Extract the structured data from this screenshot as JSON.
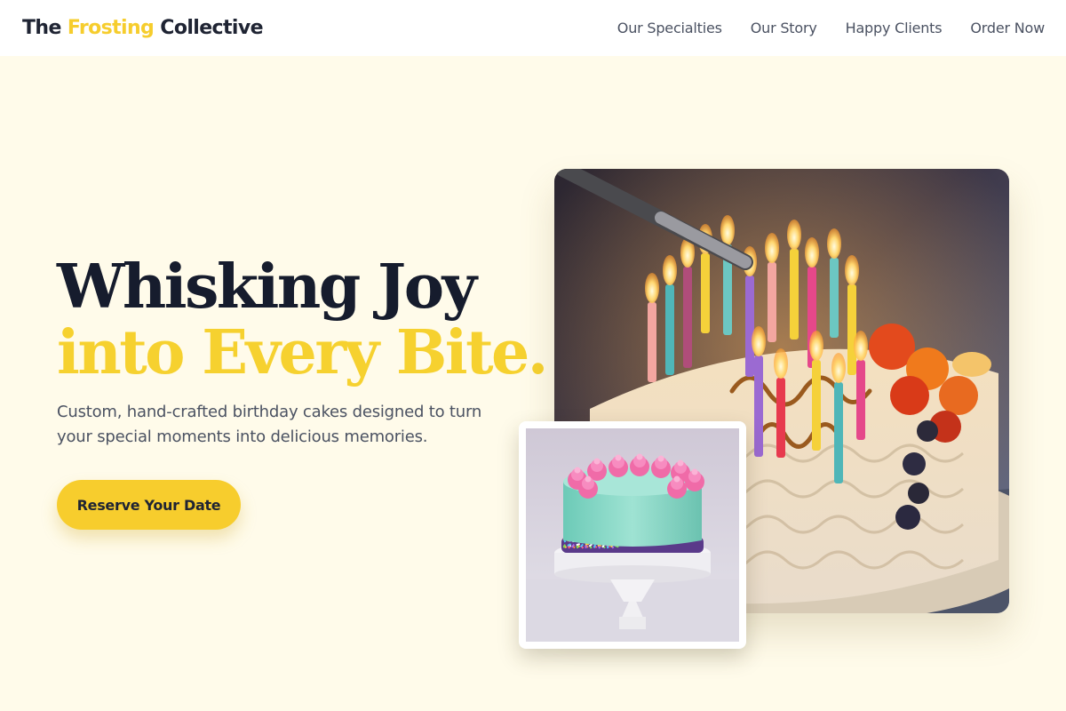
{
  "header": {
    "logo_prefix": "The ",
    "logo_accent": "Frosting",
    "logo_suffix": " Collective",
    "nav": [
      {
        "label": "Our Specialties"
      },
      {
        "label": "Our Story"
      },
      {
        "label": "Happy Clients"
      },
      {
        "label": "Order Now"
      }
    ]
  },
  "hero": {
    "title_line1": "Whisking Joy",
    "title_line2": "into Every Bite.",
    "subtitle": "Custom, hand-crafted birthday cakes designed to turn your special moments into delicious memories.",
    "cta_label": "Reserve Your Date"
  },
  "images": {
    "main_photo": "birthday-cake-candles-photo",
    "small_photo": "mint-cake-on-stand-photo"
  },
  "colors": {
    "accent": "#f6cd2d",
    "heading": "#161c2d",
    "background": "#fffbea",
    "text_muted": "#4b5262"
  }
}
